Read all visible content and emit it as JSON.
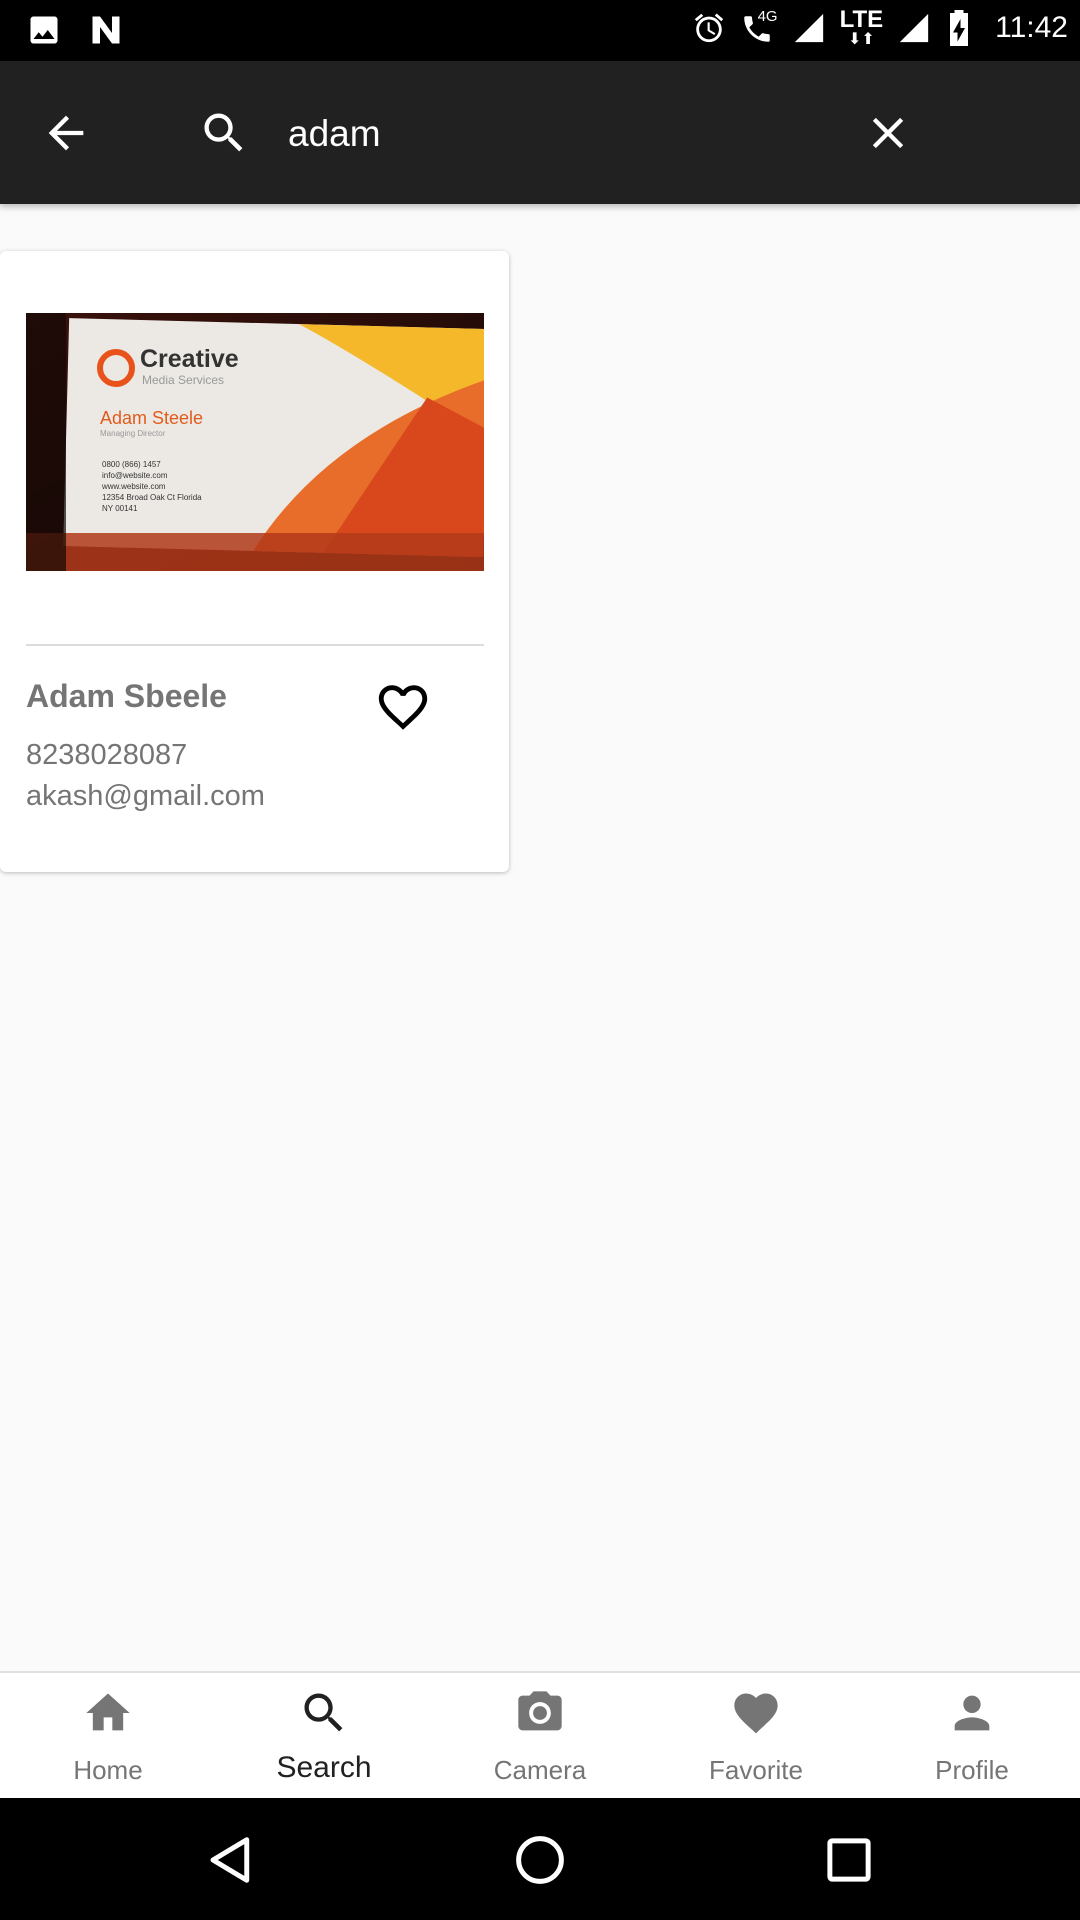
{
  "status_bar": {
    "time": "11:42",
    "network": "LTE",
    "call_badge": "4G",
    "icons": [
      "image-icon",
      "n-notification-icon",
      "alarm-icon",
      "volte-call-icon",
      "signal-icon",
      "lte-data-icon",
      "signal-icon",
      "battery-charging-icon"
    ]
  },
  "search_bar": {
    "query": "adam",
    "icons": [
      "back-arrow-icon",
      "search-icon",
      "close-icon"
    ]
  },
  "results": [
    {
      "name": "Adam Sbeele",
      "phone": "8238028087",
      "email": "akash@gmail.com",
      "favorite": false,
      "image": {
        "card_company": "Creative",
        "card_tagline": "Media Services",
        "card_name": "Adam Steele",
        "card_title": "Managing Director",
        "card_lines": [
          "0800 (866) 1457",
          "info@website.com",
          "www.website.com",
          "12354 Broad Oak Ct Florida",
          "NY 00141"
        ]
      }
    }
  ],
  "bottom_nav": {
    "items": [
      {
        "label": "Home",
        "icon": "home-icon",
        "active": false
      },
      {
        "label": "Search",
        "icon": "search-icon",
        "active": true
      },
      {
        "label": "Camera",
        "icon": "camera-icon",
        "active": false
      },
      {
        "label": "Favorite",
        "icon": "heart-icon",
        "active": false
      },
      {
        "label": "Profile",
        "icon": "person-icon",
        "active": false
      }
    ]
  },
  "colors": {
    "app_bar": "#212121",
    "background": "#fafafa",
    "text_secondary": "#757575",
    "card_accent": "#e35b1c"
  }
}
